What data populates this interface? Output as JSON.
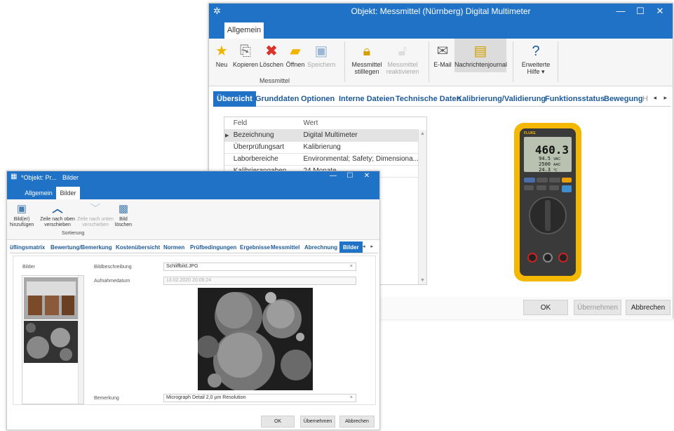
{
  "main_window": {
    "title": "Objekt:  Messmittel (Nürnberg) Digital Multimeter",
    "ribbon_tab": "Allgemein",
    "ribbon": {
      "neu": "Neu",
      "kopieren": "Kopieren",
      "loeschen": "Löschen",
      "oeffnen": "Öffnen",
      "speichern": "Speichern",
      "group_messmittel": "Messmittel",
      "stilllegen_1": "Messmittel",
      "stilllegen_2": "stilllegen",
      "reaktivieren_1": "Messmittel",
      "reaktivieren_2": "reaktivieren",
      "email": "E-Mail",
      "nachrichtenjournal": "Nachrichtenjournal",
      "hilfe_1": "Erweiterte",
      "hilfe_2": "Hilfe ▾"
    },
    "tabs": [
      "Übersicht",
      "Grunddaten",
      "Optionen",
      "Interne Dateien",
      "Technische Daten",
      "Kalibrierung/Validierung",
      "Funktionsstatus",
      "Bewegung",
      "H"
    ],
    "grid": {
      "col_feld": "Feld",
      "col_wert": "Wert",
      "rows": [
        {
          "feld": "Bezeichnung",
          "wert": "Digital Multimeter"
        },
        {
          "feld": "Überprüfungsart",
          "wert": "Kalibrierung"
        },
        {
          "feld": "Laborbereiche",
          "wert": "Environmental; Safety; Dimensiona..."
        },
        {
          "feld": "Kalibrierangaben",
          "wert": "24 Monate"
        }
      ]
    },
    "multimeter": {
      "brand": "FLUKE",
      "reading_main": "460.3",
      "reading_1": "94.5",
      "reading_2": "2500",
      "reading_3": "24.3",
      "unit_1": "VAC",
      "unit_2": "AAC",
      "unit_3": "°C"
    },
    "buttons": {
      "ok": "OK",
      "uebernehmen": "Übernehmen",
      "abbrechen": "Abbrechen"
    }
  },
  "sub_window": {
    "title": "*Objekt: Pr...",
    "context": "Bilder",
    "ribbon_tabs": [
      "Allgemein",
      "Bilder"
    ],
    "ribbon": {
      "bild_hinzufuegen_1": "Bild(er)",
      "bild_hinzufuegen_2": "hinzufügen",
      "zeile_oben_1": "Zeile nach oben",
      "zeile_oben_2": "verschieben",
      "zeile_unten_1": "Zeile nach unten",
      "zeile_unten_2": "verschieben",
      "bild_loeschen_1": "Bild",
      "bild_loeschen_2": "löschen",
      "group_sortierung": "Sortierung"
    },
    "tabs": [
      "üflingsmatrix",
      "Bewertung/Bemerkung",
      "Kostenübersicht",
      "Normen",
      "Prüfbedingungen",
      "Ergebnisse",
      "Messmittel",
      "Abrechnung",
      "Bilder"
    ],
    "form": {
      "bilder_label": "Bilder",
      "bildbeschreibung_label": "Bildbeschreibung",
      "bildbeschreibung_value": "Schliffbild.JPG",
      "aufnahmedatum_label": "Aufnahmedatum",
      "aufnahmedatum_value": "13.02.2020 20:06:24",
      "bemerkung_label": "Bemerkung",
      "bemerkung_value": "Micrograph Detail 2,0 µm Resolution"
    },
    "buttons": {
      "ok": "OK",
      "uebernehmen": "Übernehmen",
      "abbrechen": "Abbrechen"
    }
  },
  "colors": {
    "title_blue": "#1f72c6",
    "tab_text": "#1e5a99",
    "multimeter_yellow": "#f5b800"
  }
}
